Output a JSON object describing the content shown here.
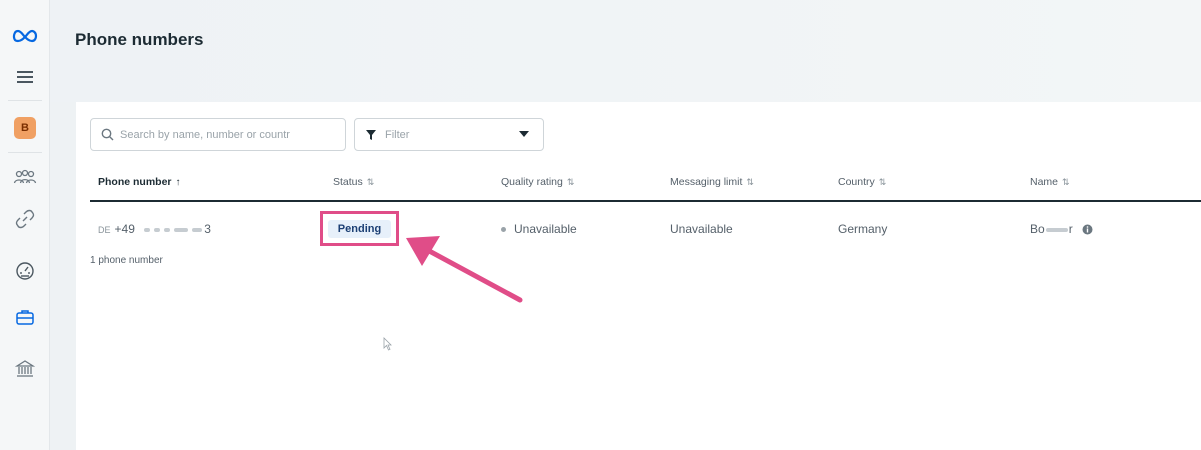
{
  "page": {
    "title": "Phone numbers"
  },
  "sidebar": {
    "brand_icon": "meta-logo-icon",
    "business_initial": "B",
    "icons": [
      "menu-icon",
      "people-icon",
      "link-icon",
      "dashboard-gauge-icon",
      "briefcase-icon",
      "bank-icon"
    ]
  },
  "toolbar": {
    "search_placeholder": "Search by name, number or countr",
    "filter_label": "Filter"
  },
  "table": {
    "columns": [
      {
        "label": "Phone number",
        "sort": "↑"
      },
      {
        "label": "Status",
        "sort": "⇅"
      },
      {
        "label": "Quality rating",
        "sort": "⇅"
      },
      {
        "label": "Messaging limit",
        "sort": "⇅"
      },
      {
        "label": "Country",
        "sort": "⇅"
      },
      {
        "label": "Name",
        "sort": "⇅"
      }
    ],
    "rows": [
      {
        "flag_code": "DE",
        "phone_prefix": "+49",
        "phone_suffix": "3",
        "status": "Pending",
        "quality_rating": "Unavailable",
        "messaging_limit": "Unavailable",
        "country": "Germany",
        "name_start": "Bo",
        "name_end": "r"
      }
    ],
    "count_label": "1 phone number"
  },
  "colors": {
    "highlight": "#e04d88",
    "pending_badge_bg": "#e7f0fa",
    "pending_badge_text": "#1c3f74",
    "meta_blue": "#0668e1",
    "business_badge": "#f0a063"
  }
}
